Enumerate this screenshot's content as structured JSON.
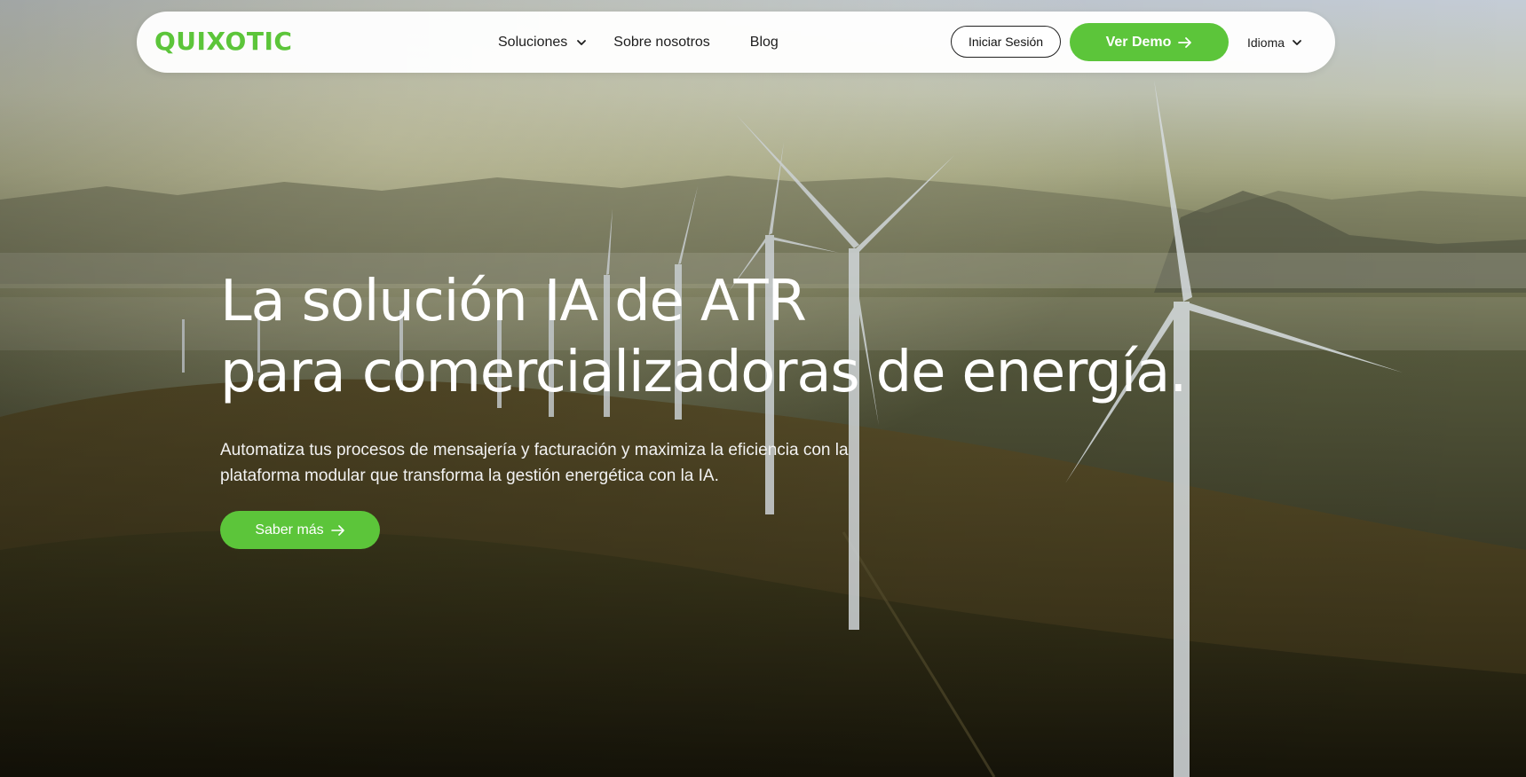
{
  "brand": {
    "logo_text": "QUIXOTIC",
    "accent_color": "#5cc53a"
  },
  "nav": {
    "items": [
      {
        "label": "Soluciones",
        "has_dropdown": true
      },
      {
        "label": "Sobre nosotros",
        "has_dropdown": false
      },
      {
        "label": "Blog",
        "has_dropdown": false
      }
    ],
    "login_label": "Iniciar Sesión",
    "demo_label": "Ver Demo",
    "language_label": "Idioma"
  },
  "hero": {
    "title_line1": "La solución IA de ATR",
    "title_line2": "para comercializadoras de energía.",
    "subtitle": "Automatiza tus procesos de mensajería y facturación y maximiza la eficiencia con la plataforma modular que transforma la gestión energética con la IA.",
    "cta_label": "Saber más",
    "background": "wind-turbines-on-misty-hills"
  },
  "icons": {
    "dropdown": "chevron-down-icon",
    "arrow": "arrow-right-icon"
  }
}
